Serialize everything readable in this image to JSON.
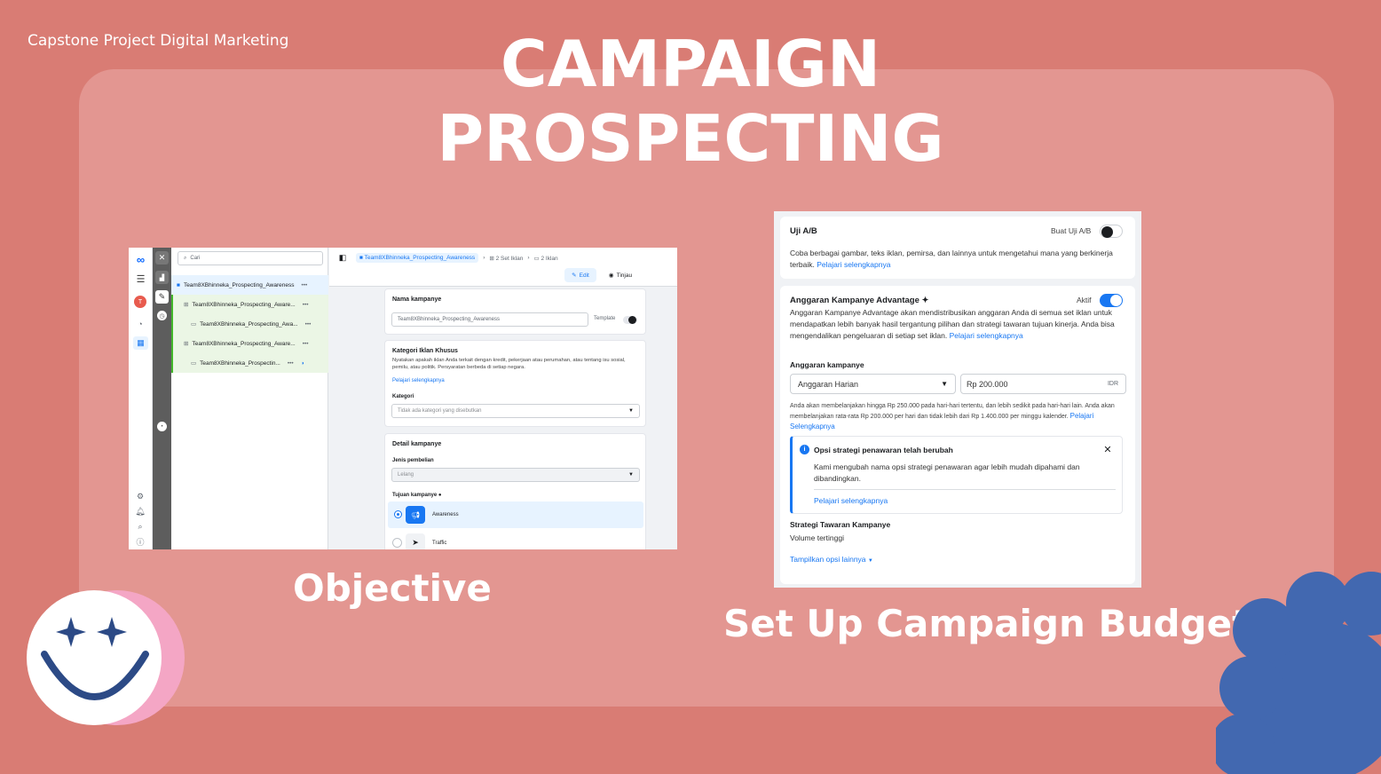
{
  "header": {
    "project_label": "Capstone Project Digital Marketing",
    "title_line1": "CAMPAIGN",
    "title_line2": "PROSPECTING"
  },
  "captions": {
    "left": "Objective",
    "right": "Set Up Campaign Budget"
  },
  "colors": {
    "background": "#d97c74",
    "inner_panel": "#e39691",
    "accent_blue": "#1877f2",
    "flower": "#4268b0",
    "smiley_shadow": "#f4a6c5"
  },
  "shot1": {
    "search_placeholder": "Cari",
    "breadcrumb": {
      "campaign": "Team8XBhinneka_Prospecting_Awareness",
      "adsets": "2 Set Iklan",
      "ads": "2 Iklan"
    },
    "actions": {
      "edit": "Edit",
      "review": "Tinjau"
    },
    "tree": [
      "Team8XBhinneka_Prospecting_Awareness",
      "Team8XBhinneka_Prospecting_Aware...",
      "Team8XBhinneka_Prospecting_Awa...",
      "Team8XBhinneka_Prospecting_Aware...",
      "Team8XBhinneka_Prospectin..."
    ],
    "more": "•••",
    "campaign_name": {
      "label": "Nama kampanye",
      "value": "Team8XBhinneka_Prospecting_Awareness",
      "template_label": "Template"
    },
    "special_category": {
      "title": "Kategori Iklan Khusus",
      "description": "Nyatakan apakah iklan Anda terkait dengan kredit, pekerjaan atau perumahan, atau tentang isu sosial, pemilu, atau politik. Persyaratan berbeda di setiap negara.",
      "learn_more": "Pelajari selengkapnya",
      "category_label": "Kategori",
      "category_value": "Tidak ada kategori yang disebutkan"
    },
    "details": {
      "title": "Detail kampanye",
      "buy_type_label": "Jenis pembelian",
      "buy_type_value": "Lelang",
      "objective_label": "Tujuan kampanye",
      "options": [
        "Awareness",
        "Traffic"
      ]
    }
  },
  "shot2": {
    "ab": {
      "title": "Uji A/B",
      "toggle_label": "Buat Uji A/B",
      "description": "Coba berbagai gambar, teks iklan, pemirsa, dan lainnya untuk mengetahui mana yang berkinerja terbaik.",
      "learn_more": "Pelajari selengkapnya"
    },
    "advantage": {
      "title": "Anggaran Kampanye Advantage",
      "sparkle": "✦",
      "status": "Aktif",
      "description": "Anggaran Kampanye Advantage akan mendistribusikan anggaran Anda di semua set iklan untuk mendapatkan lebih banyak hasil tergantung pilihan dan strategi tawaran tujuan kinerja. Anda bisa mengendalikan pengeluaran di setiap set iklan.",
      "learn_more": "Pelajari selengkapnya"
    },
    "budget": {
      "label": "Anggaran kampanye",
      "type": "Anggaran Harian",
      "amount": "Rp 200.000",
      "currency": "IDR",
      "note": "Anda akan membelanjakan hingga Rp 250.000 pada hari-hari tertentu, dan lebih sedikit pada hari-hari lain. Anda akan membelanjakan rata-rata Rp 200.000 per hari dan tidak lebih dari Rp 1.400.000 per minggu kalender.",
      "note_link": "Pelajari Selengkapnya"
    },
    "notice": {
      "title": "Opsi strategi penawaran telah berubah",
      "body": "Kami mengubah nama opsi strategi penawaran agar lebih mudah dipahami dan dibandingkan.",
      "link": "Pelajari selengkapnya"
    },
    "strategy": {
      "label": "Strategi Tawaran Kampanye",
      "value": "Volume tertinggi",
      "more": "Tampilkan opsi lainnya"
    }
  }
}
